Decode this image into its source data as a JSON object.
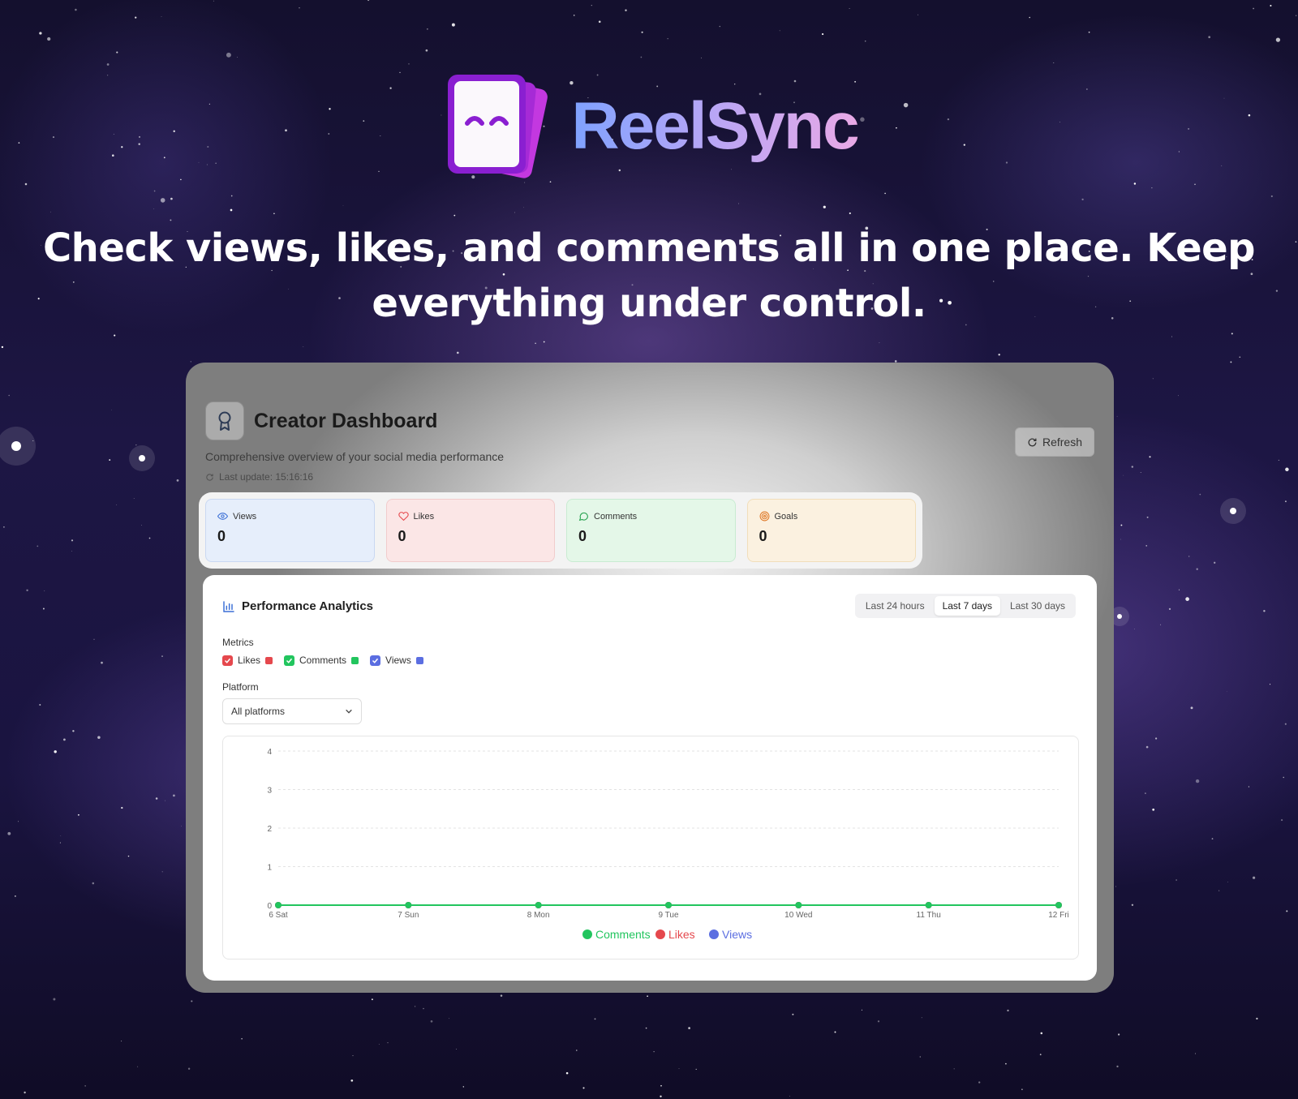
{
  "brand": {
    "name": "ReelSync"
  },
  "tagline": "Check views, likes, and comments all in one place. Keep everything under control.",
  "dashboard": {
    "title": "Creator Dashboard",
    "subtitle": "Comprehensive overview of your social media performance",
    "last_update": "Last update: 15:16:16",
    "refresh_label": "Refresh",
    "stats": [
      {
        "label": "Views",
        "value": "0",
        "icon": "eye-icon"
      },
      {
        "label": "Likes",
        "value": "0",
        "icon": "heart-icon"
      },
      {
        "label": "Comments",
        "value": "0",
        "icon": "chat-bubble-icon"
      },
      {
        "label": "Goals",
        "value": "0",
        "icon": "target-icon"
      }
    ]
  },
  "analytics": {
    "title": "Performance Analytics",
    "ranges": [
      "Last 24 hours",
      "Last 7 days",
      "Last 30 days"
    ],
    "active_range": "Last 7 days",
    "metrics_label": "Metrics",
    "metrics": [
      {
        "label": "Likes",
        "color": "#e5484d",
        "checked": true
      },
      {
        "label": "Comments",
        "color": "#22c55e",
        "checked": true
      },
      {
        "label": "Views",
        "color": "#5b6ee1",
        "checked": true
      }
    ],
    "platform_label": "Platform",
    "platform_value": "All platforms"
  },
  "chart_data": {
    "type": "line",
    "x": [
      "6 Sat",
      "7 Sun",
      "8 Mon",
      "9 Tue",
      "10 Wed",
      "11 Thu",
      "12 Fri"
    ],
    "yticks": [
      "0",
      "1",
      "2",
      "3",
      "4"
    ],
    "ylim": [
      0,
      4
    ],
    "grid": true,
    "legend_position": "bottom",
    "series": [
      {
        "name": "Comments",
        "color": "#22c55e",
        "values": [
          0,
          0,
          0,
          0,
          0,
          0,
          0
        ]
      },
      {
        "name": "Likes",
        "color": "#e5484d",
        "values": [
          0,
          0,
          0,
          0,
          0,
          0,
          0
        ]
      },
      {
        "name": "Views",
        "color": "#5b6ee1",
        "values": [
          0,
          0,
          0,
          0,
          0,
          0,
          0
        ]
      }
    ]
  }
}
